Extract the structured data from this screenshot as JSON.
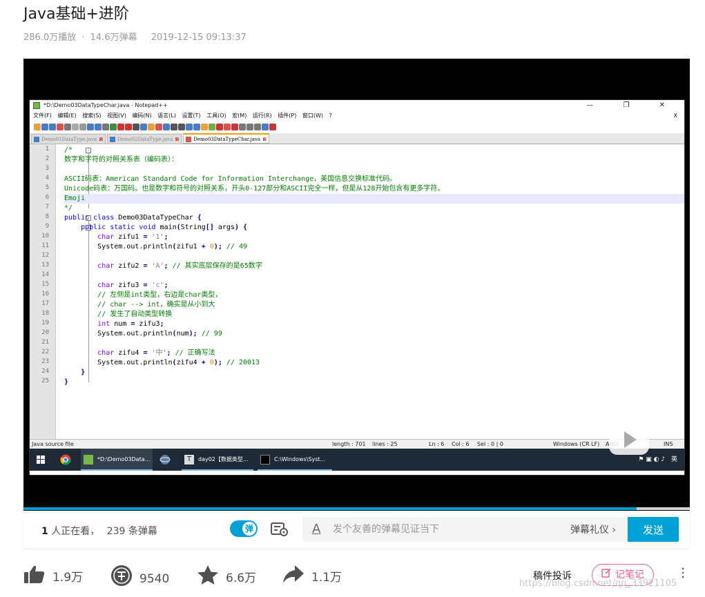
{
  "video": {
    "title": "Java基础+进阶",
    "views": "286.0万播放",
    "sep": "·",
    "danmaku_total": "14.6万弹幕",
    "publish_time": "2019-12-15 09:13:37",
    "progress": 0.92
  },
  "notepad": {
    "window_title": "*D:\\Demo03DataTypeChar.java - Notepad++",
    "window_buttons": "— ❐ ✕",
    "menu": [
      "文件(F)",
      "编辑(E)",
      "搜索(S)",
      "视图(V)",
      "编码(N)",
      "语言(L)",
      "设置(T)",
      "工具(O)",
      "宏(M)",
      "运行(R)",
      "插件(P)",
      "窗口(W)",
      "?"
    ],
    "menu_close": "X",
    "tabs": [
      {
        "label": "Demo01DataType.java",
        "close": "⊠"
      },
      {
        "label": "Demo02DataType.java",
        "close": "⊠"
      },
      {
        "label": "Demo03DataTypeChar.java",
        "close": "⊠"
      }
    ],
    "active_tab": 2,
    "code_lines": [
      "/*",
      "数字和字符的对照关系表（编码表）：",
      "",
      "ASCII码表：American Standard Code for Information Interchange，美国信息交换标准代码。",
      "Unicode码表：万国码。也是数字和符号的对照关系，开头0-127部分和ASCII完全一样，但是从128开始包含有更多字符。",
      "Emoji",
      "*/",
      "public class Demo03DataTypeChar {",
      "    public static void main(String[] args) {",
      "        char zifu1 = '1';",
      "        System.out.println(zifu1 + 0); // 49",
      "",
      "        char zifu2 = 'A'; // 其实底层保存的是65数字",
      "",
      "        char zifu3 = 'c';",
      "        // 左侧是int类型，右边是char类型，",
      "        // char --> int，确实是从小到大",
      "        // 发生了自动类型转换",
      "        int num = zifu3;",
      "        System.out.println(num); // 99",
      "",
      "        char zifu4 = '中'; // 正确写法",
      "        System.out.println(zifu4 + 0); // 20013",
      "    }",
      "}"
    ],
    "current_line": 6,
    "status": {
      "file_type": "Java source file",
      "length": "length : 701",
      "lines": "lines : 25",
      "ln": "Ln : 6",
      "col": "Col : 6",
      "sel": "Sel : 0 | 0",
      "eol": "Windows (CR LF)",
      "encoding": "ANSI",
      "mode": "INS"
    }
  },
  "taskbar": {
    "items": [
      {
        "label": "*D:\\Demo03Data..."
      },
      {
        "label": "day02【数据类型..."
      },
      {
        "label": "C:\\Windows\\Syst..."
      }
    ],
    "tray": "英"
  },
  "danmaku_bar": {
    "viewers_count": "1",
    "viewers_text": " 人正在看，",
    "danmaku_count": "239 条弹幕",
    "toggle_label": "弹",
    "input_placeholder": "发个友善的弹幕见证当下",
    "etiquette": "弹幕礼仪 ›",
    "send": "发送"
  },
  "actions": {
    "like": "1.9万",
    "coin": "9540",
    "favorite": "6.6万",
    "share": "1.1万",
    "report": "稿件投诉",
    "note": "记笔记"
  },
  "watermark": "https://blog.csdn.net/qq_33921105",
  "colors": {
    "accent": "#00a1d6",
    "pink": "#f25d8e"
  }
}
